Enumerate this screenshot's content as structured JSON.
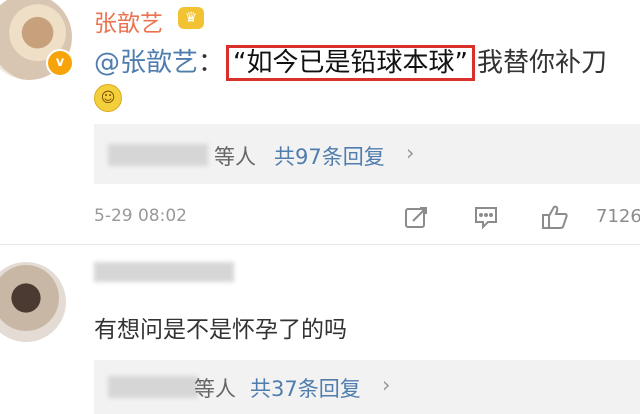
{
  "comment1": {
    "username": "张歆艺",
    "reply_mention": "@张歆艺",
    "reply_colon": "：",
    "reply_quote": "“如今已是铅球本球”",
    "reply_tail": "我替你补刀",
    "reply_summary": {
      "suffix": "等人",
      "count": "共97条回复"
    },
    "timestamp": "5-29 08:02",
    "like_count": "7126"
  },
  "comment2": {
    "text": "有想问是不是怀孕了的吗",
    "reply_summary": {
      "suffix": "等人",
      "count": "共37条回复"
    }
  },
  "colors": {
    "username": "#eb7350",
    "mention": "#4f7dae",
    "highlight_box": "#d9302b",
    "summary_bg": "#f2f2f2"
  },
  "icons": [
    "avatar",
    "verified-badge-icon",
    "crown-icon",
    "smile-emoji-icon",
    "repost-icon",
    "comment-icon",
    "like-icon",
    "chevron-right-icon"
  ]
}
